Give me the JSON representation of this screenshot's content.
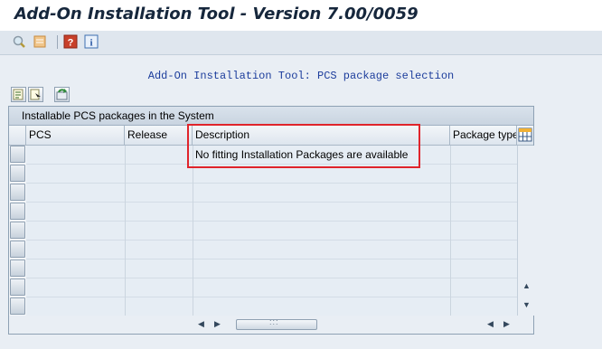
{
  "window": {
    "title": "Add-On Installation Tool - Version 7.00/0059"
  },
  "toolbar": {
    "icons": [
      "find-icon",
      "find-next-icon",
      "help-icon",
      "info-icon"
    ]
  },
  "main": {
    "heading": "Add-On Installation Tool: PCS package selection",
    "controls": [
      "details-icon",
      "select-icon",
      "refresh-icon"
    ]
  },
  "grid": {
    "caption": "Installable PCS packages in the System",
    "columns": [
      "PCS",
      "Release",
      "Description",
      "Package type"
    ],
    "message": "No fitting Installation Packages are available",
    "empty_rows": 9
  },
  "colors": {
    "heading": "#1c3d9c",
    "highlight": "#e0242b"
  }
}
